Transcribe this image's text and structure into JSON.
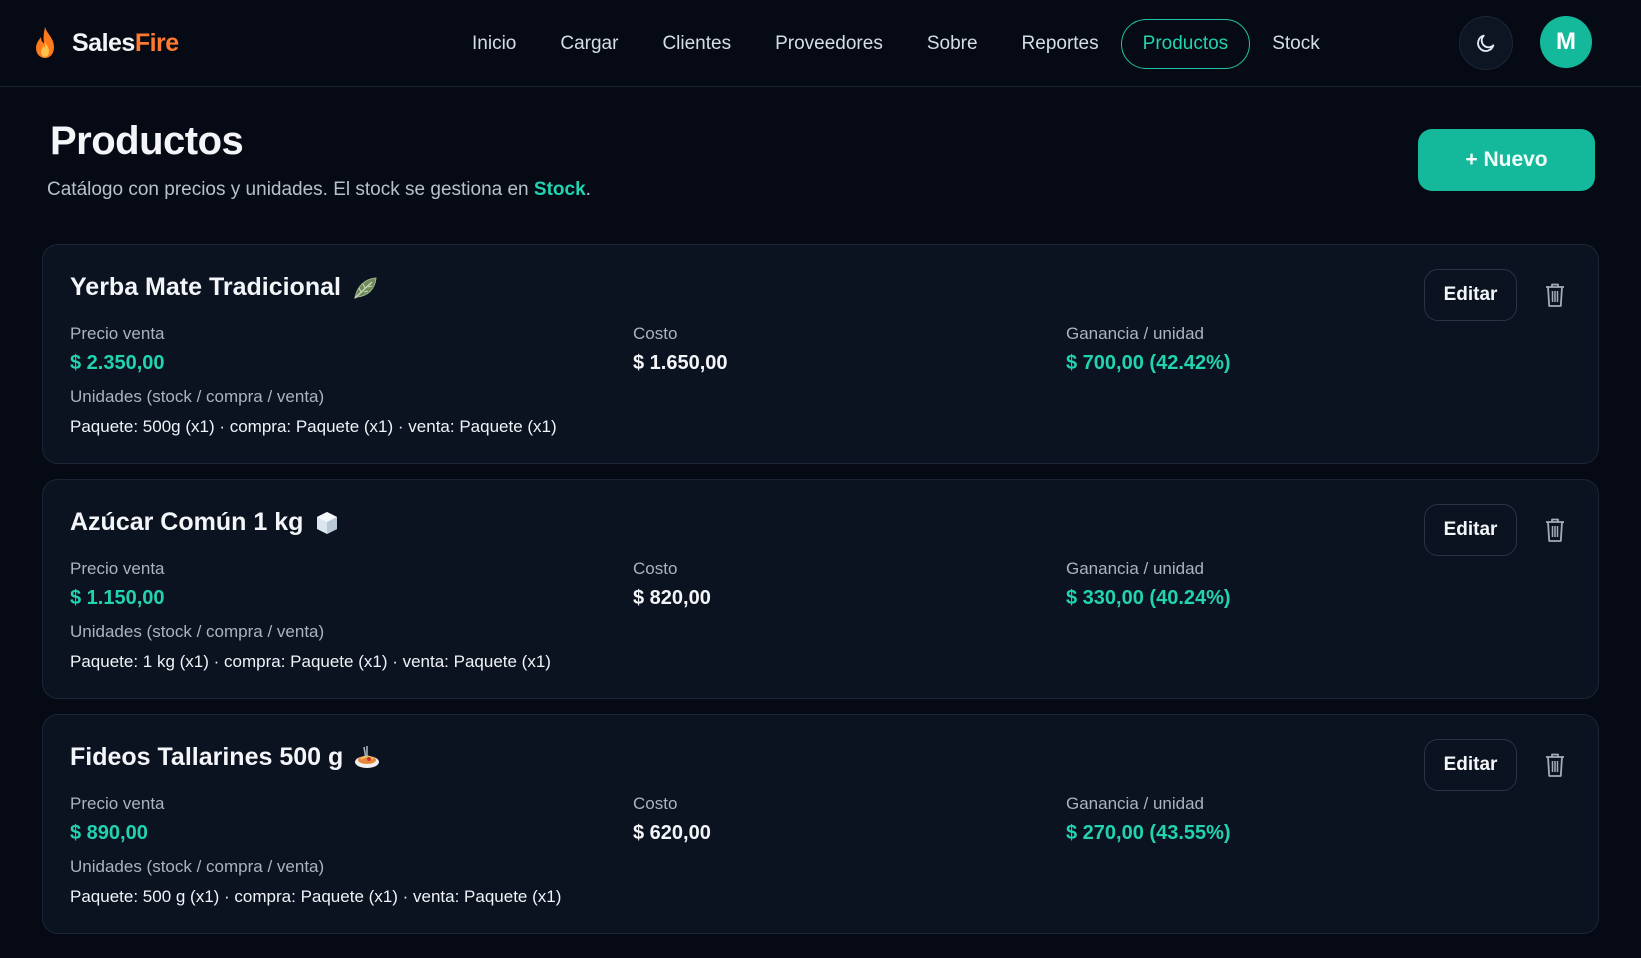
{
  "brand": {
    "name_a": "Sales",
    "name_b": "Fire"
  },
  "nav": {
    "items": [
      {
        "label": "Inicio"
      },
      {
        "label": "Cargar"
      },
      {
        "label": "Clientes"
      },
      {
        "label": "Proveedores"
      },
      {
        "label": "Sobre"
      },
      {
        "label": "Reportes"
      },
      {
        "label": "Productos",
        "active": true
      },
      {
        "label": "Stock"
      }
    ]
  },
  "user": {
    "initial": "M"
  },
  "page": {
    "title": "Productos",
    "subtitle_pre": "Catálogo con precios y unidades. El stock se gestiona en ",
    "subtitle_link": "Stock",
    "subtitle_post": ".",
    "new_label": "+ Nuevo"
  },
  "labels": {
    "price": "Precio venta",
    "cost": "Costo",
    "profit": "Ganancia / unidad",
    "units": "Unidades (stock / compra / venta)",
    "edit": "Editar"
  },
  "products": [
    {
      "name": "Yerba Mate Tradicional",
      "icon": "leaf-icon",
      "price": "$ 2.350,00",
      "cost": "$ 1.650,00",
      "profit": "$ 700,00 (42.42%)",
      "units": "Paquete: 500g (x1) · compra: Paquete (x1) · venta: Paquete (x1)"
    },
    {
      "name": "Azúcar Común 1 kg",
      "icon": "ice-cube-icon",
      "price": "$ 1.150,00",
      "cost": "$ 820,00",
      "profit": "$ 330,00 (40.24%)",
      "units": "Paquete: 1 kg (x1) · compra: Paquete (x1) · venta: Paquete (x1)"
    },
    {
      "name": "Fideos Tallarines 500 g",
      "icon": "spaghetti-icon",
      "price": "$ 890,00",
      "cost": "$ 620,00",
      "profit": "$ 270,00 (43.55%)",
      "units": "Paquete: 500 g (x1) · compra: Paquete (x1) · venta: Paquete (x1)"
    }
  ],
  "colors": {
    "accent": "#22d3b0",
    "brand_orange": "#ff7a2f",
    "background": "#050a14",
    "card": "#0b1220"
  }
}
